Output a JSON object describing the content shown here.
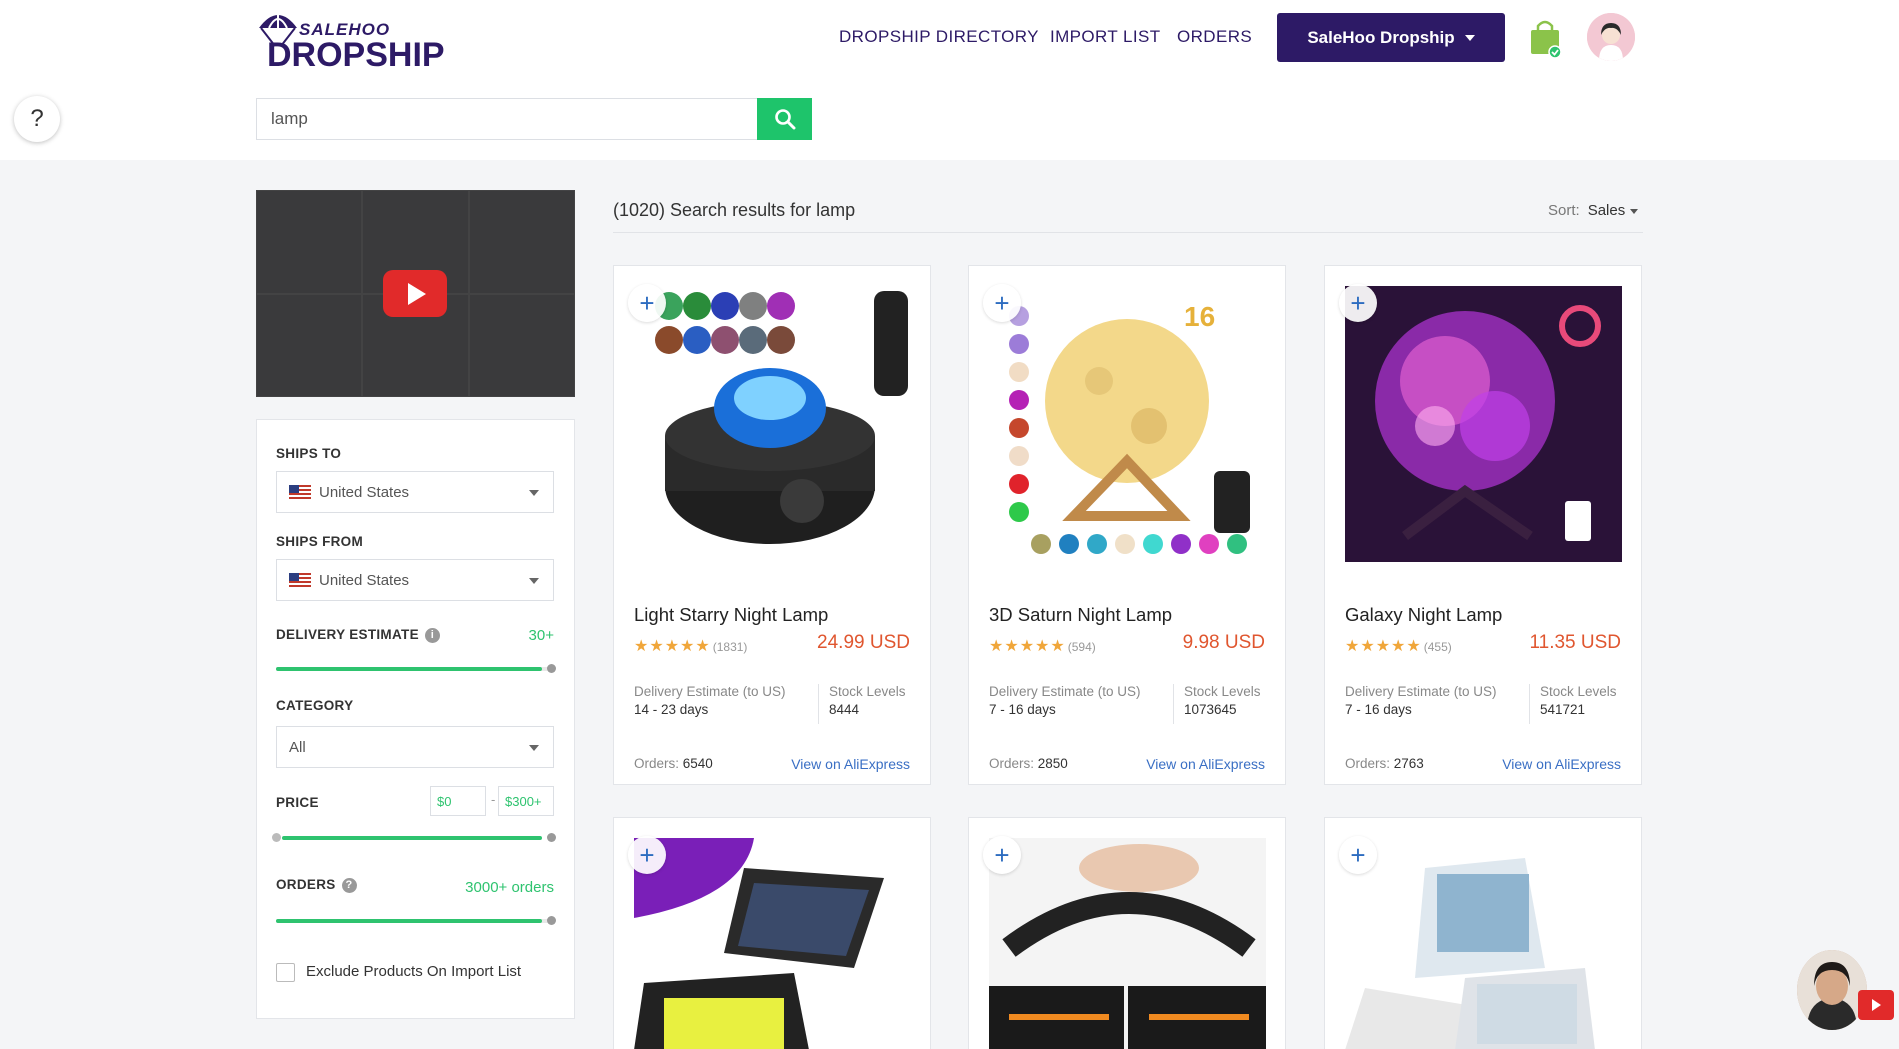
{
  "header": {
    "logo_top": "SALEHOO",
    "logo_main": "DROPSHIP",
    "nav": [
      "DROPSHIP DIRECTORY",
      "IMPORT LIST",
      "ORDERS"
    ],
    "account_button": "SaleHoo Dropship"
  },
  "help": {
    "label": "?"
  },
  "search": {
    "value": "lamp",
    "placeholder": ""
  },
  "filters": {
    "ships_to_label": "SHIPS TO",
    "ships_to_value": "United States",
    "ships_from_label": "SHIPS FROM",
    "ships_from_value": "United States",
    "delivery_label": "DELIVERY ESTIMATE",
    "delivery_value": "30+",
    "category_label": "CATEGORY",
    "category_value": "All",
    "price_label": "PRICE",
    "price_min": "$0",
    "price_sep": "-",
    "price_max": "$300+",
    "orders_label": "ORDERS",
    "orders_value": "3000+ orders",
    "exclude_label": "Exclude Products On Import List"
  },
  "results": {
    "title": "(1020) Search results for lamp",
    "sort_label": "Sort:",
    "sort_value": "Sales"
  },
  "products": [
    {
      "title": "Light Starry Night Lamp",
      "stars": "★★★★★",
      "reviews": "(1831)",
      "price": "24.99 USD",
      "delivery_label": "Delivery Estimate (to US)",
      "delivery": "14 - 23 days",
      "stock_label": "Stock Levels",
      "stock": "8444",
      "orders_label": "Orders:",
      "orders": "6540",
      "link": "View on AliExpress"
    },
    {
      "title": "3D Saturn Night Lamp",
      "stars": "★★★★★",
      "reviews": "(594)",
      "price": "9.98 USD",
      "delivery_label": "Delivery Estimate (to US)",
      "delivery": "7 - 16 days",
      "stock_label": "Stock Levels",
      "stock": "1073645",
      "orders_label": "Orders:",
      "orders": "2850",
      "link": "View on AliExpress"
    },
    {
      "title": "Galaxy Night Lamp",
      "stars": "★★★★★",
      "reviews": "(455)",
      "price": "11.35 USD",
      "delivery_label": "Delivery Estimate (to US)",
      "delivery": "7 - 16 days",
      "stock_label": "Stock Levels",
      "stock": "541721",
      "orders_label": "Orders:",
      "orders": "2763",
      "link": "View on AliExpress"
    }
  ],
  "colors": {
    "brand": "#2d1a66",
    "accent_green": "#2ec36f",
    "price": "#e0562f",
    "link": "#3a6fc4"
  }
}
